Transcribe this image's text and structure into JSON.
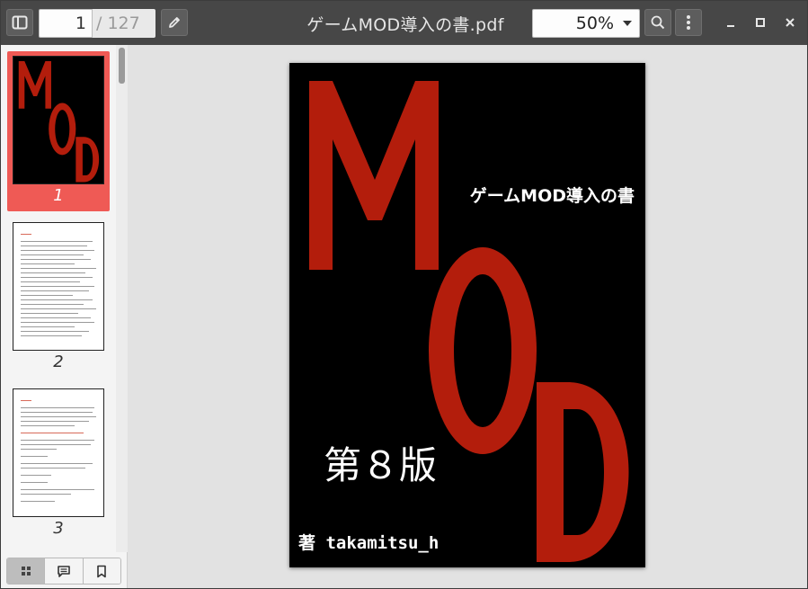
{
  "toolbar": {
    "page_current": "1",
    "page_total": "/ 127",
    "doc_title": "ゲームMOD導入の書.pdf",
    "zoom": "50%"
  },
  "thumbnails": [
    {
      "num": "1"
    },
    {
      "num": "2"
    },
    {
      "num": "3"
    }
  ],
  "cover": {
    "big_letters": [
      "M",
      "O",
      "D"
    ],
    "title": "ゲームMOD導入の書",
    "edition": "第８版",
    "author": "著 takamitsu_h",
    "colors": {
      "background": "#000000",
      "letters": "#b31d0c",
      "text": "#ffffff"
    }
  },
  "icons": {
    "sidebar_toggle": "sidebar-toggle-icon",
    "annotate": "pencil-icon",
    "search": "search-icon",
    "more": "more-vertical-icon",
    "minimize": "minimize-icon",
    "maximize": "maximize-icon",
    "close": "close-icon",
    "thumbnails_tab": "grid-icon",
    "annotations_tab": "comment-icon",
    "bookmarks_tab": "bookmark-icon"
  },
  "colors": {
    "accent_selected": "#ef5a55",
    "toolbar": "#474747"
  }
}
